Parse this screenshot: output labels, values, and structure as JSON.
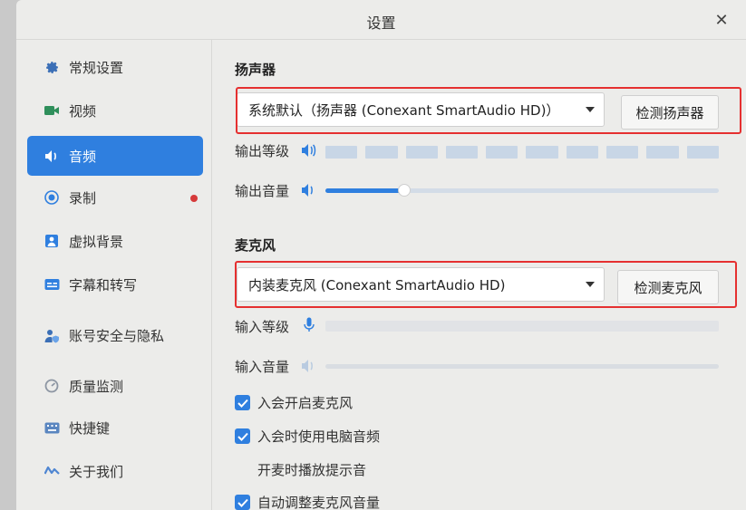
{
  "window": {
    "title": "设置"
  },
  "sidebar": {
    "items": [
      {
        "label": "常规设置",
        "icon": "gear-icon",
        "active": false
      },
      {
        "label": "视频",
        "icon": "video-icon",
        "active": false
      },
      {
        "label": "音频",
        "icon": "speaker-icon",
        "active": true
      },
      {
        "label": "录制",
        "icon": "record-icon",
        "active": false,
        "badge_dot": true
      },
      {
        "label": "虚拟背景",
        "icon": "virtual-background-icon",
        "active": false
      },
      {
        "label": "字幕和转写",
        "icon": "captions-icon",
        "active": false
      },
      {
        "label": "账号安全与隐私",
        "icon": "account-security-icon",
        "active": false
      },
      {
        "label": "质量监测",
        "icon": "quality-monitor-icon",
        "active": false
      },
      {
        "label": "快捷键",
        "icon": "keyboard-icon",
        "active": false
      },
      {
        "label": "关于我们",
        "icon": "about-icon",
        "active": false
      }
    ]
  },
  "speaker": {
    "section_title": "扬声器",
    "device_selected": "系统默认（扬声器 (Conexant SmartAudio HD)）",
    "test_button": "检测扬声器",
    "output_level_label": "输出等级",
    "output_level_segments": 10,
    "output_volume_label": "输出音量",
    "output_volume_fraction": 0.2
  },
  "microphone": {
    "section_title": "麦克风",
    "device_selected": "内装麦克风 (Conexant SmartAudio HD)",
    "test_button": "检测麦克风",
    "input_level_label": "输入等级",
    "input_volume_label": "输入音量"
  },
  "options": [
    {
      "label": "入会开启麦克风",
      "checked": true
    },
    {
      "label": "入会时使用电脑音频",
      "checked": true
    },
    {
      "label": "开麦时播放提示音",
      "checked": false
    },
    {
      "label": "自动调整麦克风音量",
      "checked": true
    }
  ],
  "colors": {
    "accent": "#2f7fdf",
    "highlight": "#e53030",
    "record_dot": "#d63a3a"
  }
}
